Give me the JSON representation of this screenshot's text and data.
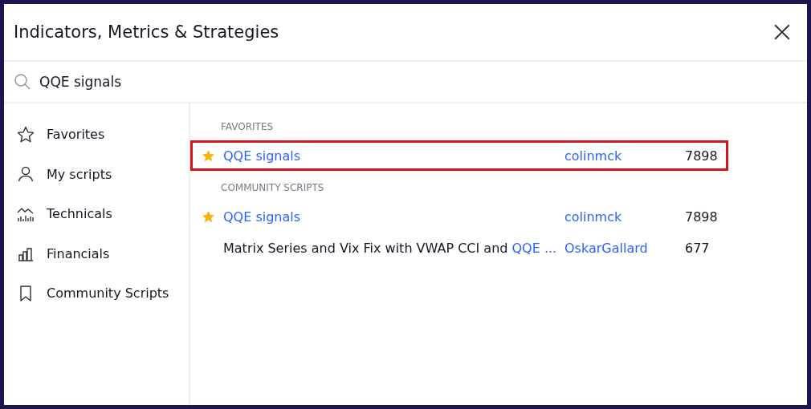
{
  "dialog": {
    "title": "Indicators, Metrics & Strategies"
  },
  "search": {
    "value": "QQE signals"
  },
  "sidebar": {
    "items": [
      {
        "label": "Favorites",
        "kind": "star",
        "selected": false
      },
      {
        "label": "My scripts",
        "kind": "person",
        "selected": false
      },
      {
        "label": "Technicals",
        "kind": "chart",
        "selected": false
      },
      {
        "label": "Financials",
        "kind": "bars",
        "selected": false
      },
      {
        "label": "Community Scripts",
        "kind": "bookmark",
        "selected": false
      }
    ]
  },
  "sections": [
    {
      "heading": "FAVORITES",
      "rows": [
        {
          "favorite": true,
          "highlighted": true,
          "title_parts": [
            {
              "text": "QQE signals",
              "match": true
            }
          ],
          "author": "colinmck",
          "count": "7898"
        }
      ]
    },
    {
      "heading": "COMMUNITY SCRIPTS",
      "rows": [
        {
          "favorite": true,
          "highlighted": false,
          "title_parts": [
            {
              "text": "QQE signals",
              "match": true
            }
          ],
          "author": "colinmck",
          "count": "7898"
        },
        {
          "favorite": false,
          "highlighted": false,
          "title_parts": [
            {
              "text": "Matrix Series and Vix Fix with VWAP CCI and ",
              "match": false
            },
            {
              "text": "QQE ...",
              "match": true
            }
          ],
          "author": "OskarGallard",
          "count": "677"
        }
      ]
    }
  ]
}
